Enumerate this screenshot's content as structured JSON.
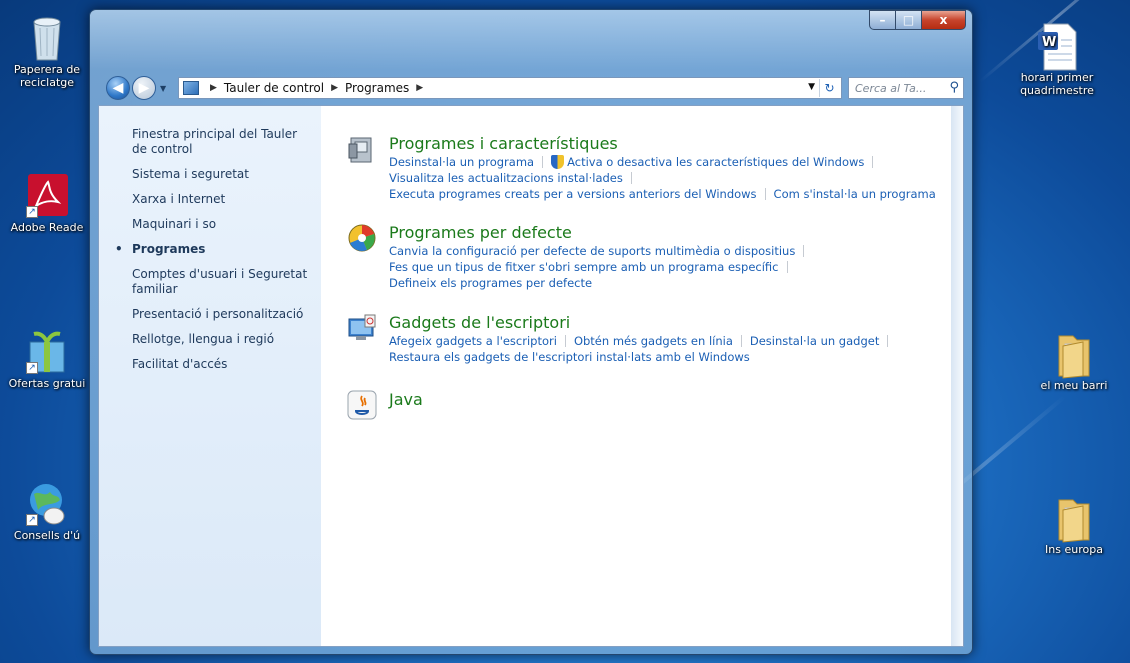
{
  "desktop": {
    "icons_left": [
      {
        "label": "Paperera de reciclatge",
        "icon": "recycle-bin-icon"
      },
      {
        "label": "Adobe Reade",
        "icon": "adobe-reader-icon"
      },
      {
        "label": "Ofertas gratui",
        "icon": "gift-offers-icon"
      },
      {
        "label": "Consells d'ú",
        "icon": "tips-globe-icon"
      }
    ],
    "icons_right": [
      {
        "label": "horari primer quadrimestre",
        "icon": "word-document-icon"
      },
      {
        "label": "el meu barri",
        "icon": "folder-icon"
      },
      {
        "label": "Ins europa",
        "icon": "folder-icon"
      }
    ]
  },
  "window": {
    "caption_buttons": {
      "minimize": "–",
      "maximize": "□",
      "close": "x"
    },
    "nav": {
      "back_icon": "arrow-left-icon",
      "forward_icon": "arrow-right-icon"
    },
    "breadcrumb": [
      "Tauler de control",
      "Programes"
    ],
    "search_placeholder": "Cerca al Ta...",
    "sidebar": [
      {
        "label": "Finestra principal del Tauler de control",
        "active": false
      },
      {
        "label": "Sistema i seguretat",
        "active": false
      },
      {
        "label": "Xarxa i Internet",
        "active": false
      },
      {
        "label": "Maquinari i so",
        "active": false
      },
      {
        "label": "Programes",
        "active": true
      },
      {
        "label": "Comptes d'usuari i Seguretat familiar",
        "active": false
      },
      {
        "label": "Presentació i personalització",
        "active": false
      },
      {
        "label": "Rellotge, llengua i regió",
        "active": false
      },
      {
        "label": "Facilitat d'accés",
        "active": false
      }
    ],
    "categories": {
      "programs_features": {
        "title": "Programes i característiques",
        "link1": "Desinstal·la un programa",
        "link2": "Activa o desactiva les característiques del Windows",
        "link3": "Visualitza les actualitzacions instal·lades",
        "link4": "Executa programes creats per a versions anteriors del Windows",
        "link5": "Com s'instal·la un programa"
      },
      "default_programs": {
        "title": "Programes per defecte",
        "link1": "Canvia la configuració per defecte de suports multimèdia o dispositius",
        "link2": "Fes que un tipus de fitxer s'obri sempre amb un programa específic",
        "link3": "Defineix els programes per defecte"
      },
      "gadgets": {
        "title": "Gadgets de l'escriptori",
        "link1": "Afegeix gadgets a l'escriptori",
        "link2": "Obtén més gadgets en línia",
        "link3": "Desinstal·la un gadget",
        "link4": "Restaura els gadgets de l'escriptori instal·lats amb el Windows"
      },
      "java": {
        "title": "Java"
      }
    }
  }
}
